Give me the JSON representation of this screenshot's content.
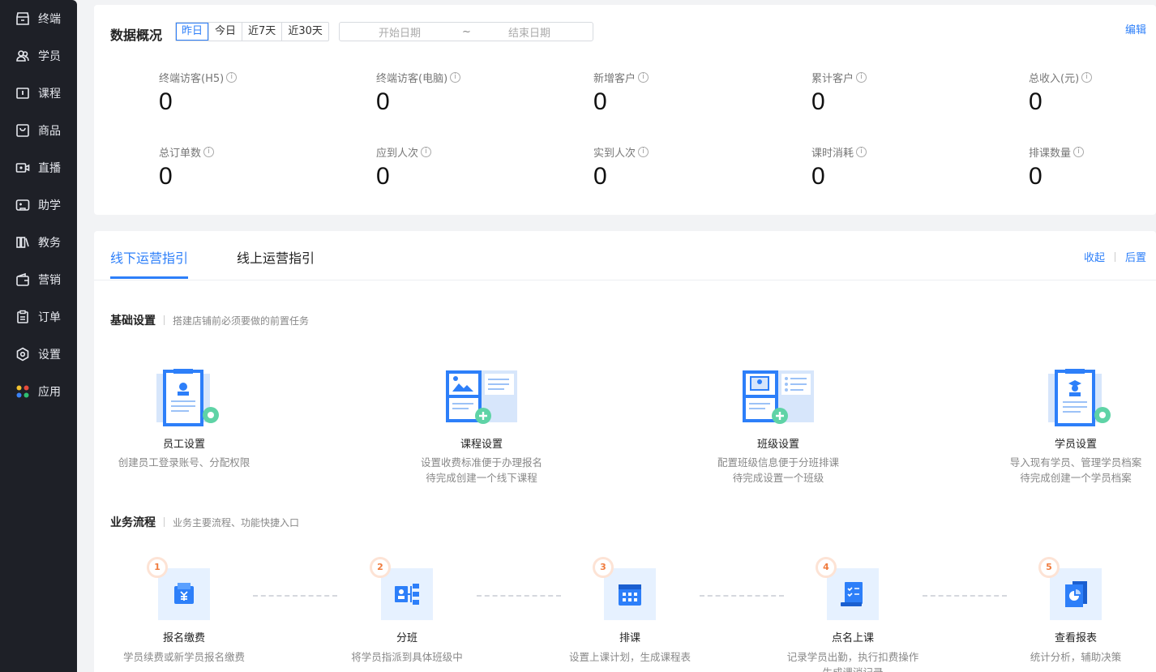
{
  "sidebar": {
    "items": [
      {
        "label": "终端",
        "icon": "terminal-icon"
      },
      {
        "label": "学员",
        "icon": "users-icon"
      },
      {
        "label": "课程",
        "icon": "course-icon"
      },
      {
        "label": "商品",
        "icon": "goods-icon"
      },
      {
        "label": "直播",
        "icon": "live-icon"
      },
      {
        "label": "助学",
        "icon": "gamepad-icon"
      },
      {
        "label": "教务",
        "icon": "books-icon"
      },
      {
        "label": "营销",
        "icon": "wallet-icon"
      },
      {
        "label": "订单",
        "icon": "clipboard-icon"
      },
      {
        "label": "设置",
        "icon": "settings-icon"
      },
      {
        "label": "应用",
        "icon": "apps-icon"
      }
    ]
  },
  "overview": {
    "title": "数据概况",
    "ranges": [
      "昨日",
      "今日",
      "近7天",
      "近30天"
    ],
    "active_range": "昨日",
    "date_start_placeholder": "开始日期",
    "date_sep": "~",
    "date_end_placeholder": "结束日期",
    "edit_label": "编辑",
    "stats": [
      {
        "label": "终端访客(H5)",
        "value": "0"
      },
      {
        "label": "终端访客(电脑)",
        "value": "0"
      },
      {
        "label": "新增客户",
        "value": "0"
      },
      {
        "label": "累计客户",
        "value": "0"
      },
      {
        "label": "总收入(元)",
        "value": "0"
      },
      {
        "label": "总订单数",
        "value": "0"
      },
      {
        "label": "应到人次",
        "value": "0"
      },
      {
        "label": "实到人次",
        "value": "0"
      },
      {
        "label": "课时消耗",
        "value": "0"
      },
      {
        "label": "排课数量",
        "value": "0"
      }
    ],
    "info_glyph": "i"
  },
  "guide": {
    "tabs": [
      "线下运营指引",
      "线上运营指引"
    ],
    "collapse_label": "收起",
    "later_label": "后置",
    "basic": {
      "title": "基础设置",
      "subtitle": "搭建店铺前必须要做的前置任务",
      "items": [
        {
          "name": "员工设置",
          "desc1": "创建员工登录账号、分配权限",
          "desc2": ""
        },
        {
          "name": "课程设置",
          "desc1": "设置收费标准便于办理报名",
          "desc2": "待完成创建一个线下课程"
        },
        {
          "name": "班级设置",
          "desc1": "配置班级信息便于分班排课",
          "desc2": "待完成设置一个班级"
        },
        {
          "name": "学员设置",
          "desc1": "导入现有学员、管理学员档案",
          "desc2": "待完成创建一个学员档案"
        }
      ]
    },
    "flow": {
      "title": "业务流程",
      "subtitle": "业务主要流程、功能快捷入口",
      "steps": [
        {
          "num": "1",
          "name": "报名缴费",
          "desc1": "学员续费或新学员报名缴费",
          "desc2": "",
          "icon": "payment-icon"
        },
        {
          "num": "2",
          "name": "分班",
          "desc1": "将学员指派到具体班级中",
          "desc2": "",
          "icon": "assign-class-icon"
        },
        {
          "num": "3",
          "name": "排课",
          "desc1": "设置上课计划，生成课程表",
          "desc2": "",
          "icon": "calendar-icon"
        },
        {
          "num": "4",
          "name": "点名上课",
          "desc1": "记录学员出勤，执行扣费操作",
          "desc2": "生成课消记录",
          "icon": "roll-call-icon"
        },
        {
          "num": "5",
          "name": "查看报表",
          "desc1": "统计分析，辅助决策",
          "desc2": "",
          "icon": "report-icon"
        }
      ]
    }
  },
  "colors": {
    "accent": "#2d7ff9",
    "sidebar_bg": "#1e2027",
    "step_badge": "#f07b3d"
  }
}
